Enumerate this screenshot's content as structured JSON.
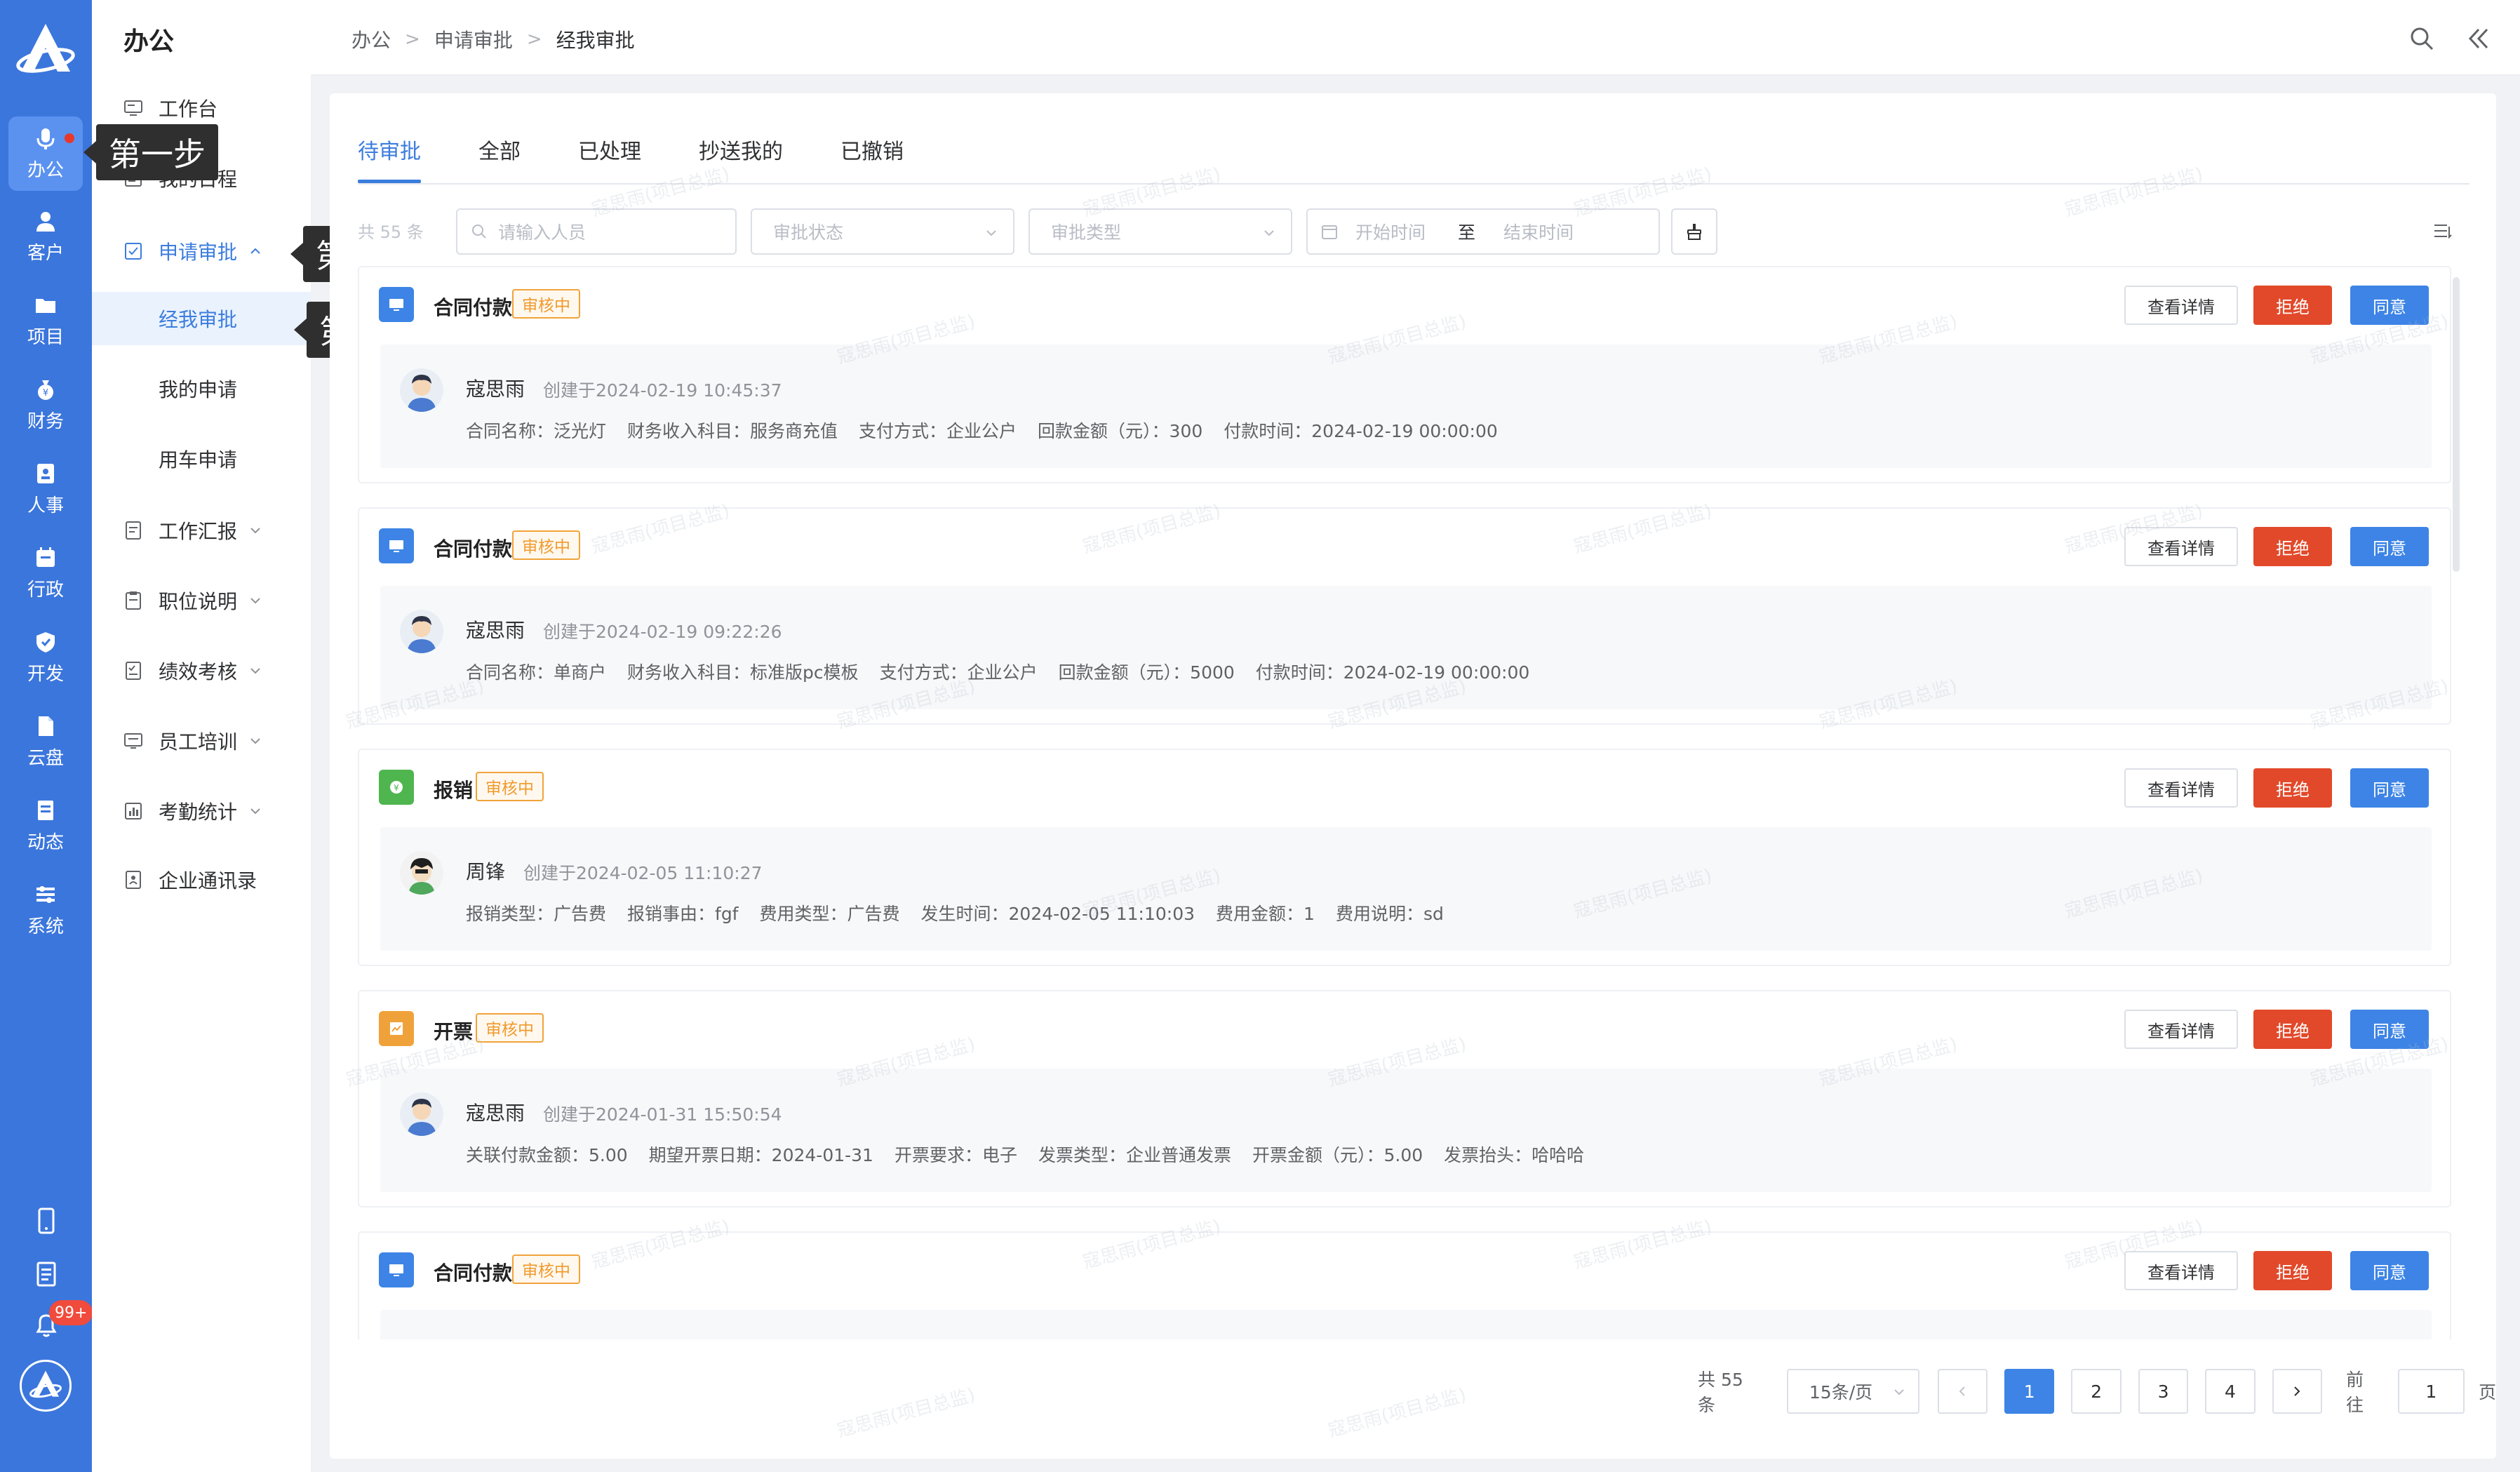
{
  "colors": {
    "primary": "#3b76dc",
    "accent": "#3d84e6",
    "danger": "#e2492a",
    "warning": "#f19a2c"
  },
  "rail": {
    "logo_icon": "app-logo",
    "items": [
      {
        "label": "办公",
        "icon": "mic-icon"
      },
      {
        "label": "客户",
        "icon": "user-icon"
      },
      {
        "label": "项目",
        "icon": "folder-icon"
      },
      {
        "label": "财务",
        "icon": "money-bag-icon"
      },
      {
        "label": "人事",
        "icon": "id-card-icon"
      },
      {
        "label": "行政",
        "icon": "calendar-icon"
      },
      {
        "label": "开发",
        "icon": "shield-icon"
      },
      {
        "label": "云盘",
        "icon": "cloud-file-icon"
      },
      {
        "label": "动态",
        "icon": "document-icon"
      },
      {
        "label": "系统",
        "icon": "settings-sliders-icon"
      }
    ],
    "notification_badge": "99+"
  },
  "subnav": {
    "title": "办公",
    "items": [
      {
        "label": "工作台"
      },
      {
        "label": "我的日程"
      },
      {
        "label": "申请审批"
      },
      {
        "label": "经我审批"
      },
      {
        "label": "我的申请"
      },
      {
        "label": "用车申请"
      },
      {
        "label": "工作汇报"
      },
      {
        "label": "职位说明"
      },
      {
        "label": "绩效考核"
      },
      {
        "label": "员工培训"
      },
      {
        "label": "考勤统计"
      },
      {
        "label": "企业通讯录"
      }
    ]
  },
  "steps": {
    "step1": "第一步",
    "step2": "第二步",
    "step3": "第三步"
  },
  "breadcrumb": [
    "办公",
    "申请审批",
    "经我审批"
  ],
  "tabs": [
    "待审批",
    "全部",
    "已处理",
    "抄送我的",
    "已撤销"
  ],
  "filters": {
    "total_hint": "共 55 条",
    "people_placeholder": "请输入人员",
    "status_placeholder": "审批状态",
    "type_placeholder": "审批类型",
    "date_start": "开始时间",
    "date_to": "至",
    "date_end": "结束时间"
  },
  "buttons": {
    "detail": "查看详情",
    "reject": "拒绝",
    "agree": "同意"
  },
  "records": [
    {
      "type": "合同付款",
      "status": "审核中",
      "icon_color": "#3d84e6",
      "user": "寇思雨",
      "created": "创建于2024-02-19 10:45:37",
      "fields": [
        "合同名称：泛光灯",
        "财务收入科目：服务商充值",
        "支付方式：企业公户",
        "回款金额（元）：300",
        "付款时间：2024-02-19 00:00:00"
      ]
    },
    {
      "type": "合同付款",
      "status": "审核中",
      "icon_color": "#3d84e6",
      "user": "寇思雨",
      "created": "创建于2024-02-19 09:22:26",
      "fields": [
        "合同名称：单商户",
        "财务收入科目：标准版pc模板",
        "支付方式：企业公户",
        "回款金额（元）：5000",
        "付款时间：2024-02-19 00:00:00"
      ]
    },
    {
      "type": "报销",
      "status": "审核中",
      "icon_color": "#4fb54e",
      "user": "周锋",
      "created": "创建于2024-02-05 11:10:27",
      "fields": [
        "报销类型：广告费",
        "报销事由：fgf",
        "费用类型：广告费",
        "发生时间：2024-02-05 11:10:03",
        "费用金额：1",
        "费用说明：sd"
      ]
    },
    {
      "type": "开票",
      "status": "审核中",
      "icon_color": "#f0a23a",
      "user": "寇思雨",
      "created": "创建于2024-01-31 15:50:54",
      "fields": [
        "关联付款金额：5.00",
        "期望开票日期：2024-01-31",
        "开票要求：电子",
        "发票类型：企业普通发票",
        "开票金额（元）：5.00",
        "发票抬头：哈哈哈"
      ]
    },
    {
      "type": "合同付款",
      "status": "审核中",
      "icon_color": "#3d84e6",
      "user": "",
      "created": "",
      "fields": []
    }
  ],
  "pagination": {
    "total": "共 55 条",
    "page_size": "15条/页",
    "pages": [
      "1",
      "2",
      "3",
      "4"
    ],
    "current": "1",
    "goto_label": "前往",
    "goto_value": "1",
    "goto_unit": "页"
  },
  "watermark": "寇思雨(项目总监)"
}
